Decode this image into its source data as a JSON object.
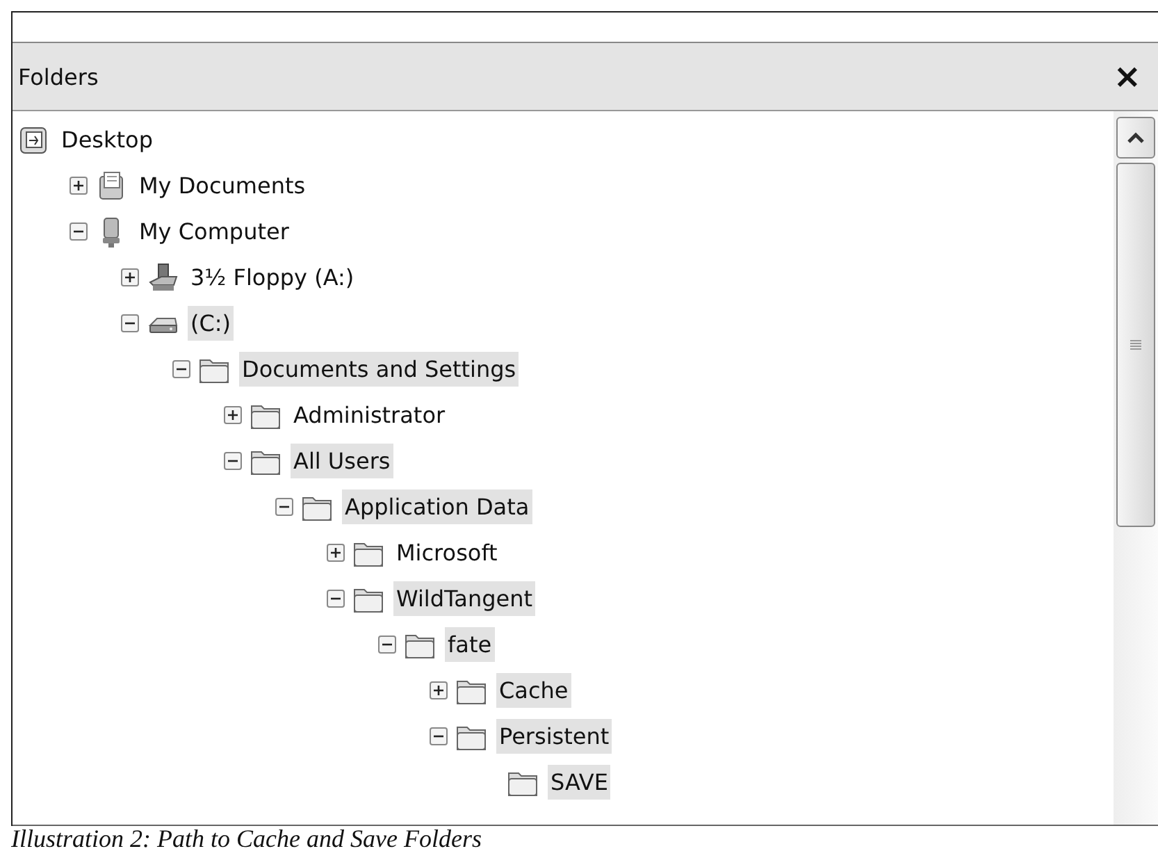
{
  "panel": {
    "title": "Folders",
    "close": "×"
  },
  "tree": [
    {
      "label": "Desktop",
      "kind": "desktop",
      "highlighted": false,
      "children": [
        {
          "label": "My Documents",
          "kind": "documents",
          "expanded": false,
          "highlighted": false
        },
        {
          "label": "My Computer",
          "kind": "computer",
          "expanded": true,
          "highlighted": false,
          "children": [
            {
              "label": "3½ Floppy (A:)",
              "kind": "floppy",
              "expanded": false,
              "highlighted": false
            },
            {
              "label": "(C:)",
              "kind": "drive",
              "expanded": true,
              "highlighted": true,
              "children": [
                {
                  "label": "Documents and Settings",
                  "kind": "folder",
                  "expanded": true,
                  "highlighted": true,
                  "children": [
                    {
                      "label": "Administrator",
                      "kind": "folder",
                      "expanded": false,
                      "highlighted": false
                    },
                    {
                      "label": "All Users",
                      "kind": "folder",
                      "expanded": true,
                      "highlighted": true,
                      "children": [
                        {
                          "label": "Application Data",
                          "kind": "folder",
                          "expanded": true,
                          "highlighted": true,
                          "children": [
                            {
                              "label": "Microsoft",
                              "kind": "folder",
                              "expanded": false,
                              "highlighted": false
                            },
                            {
                              "label": "WildTangent",
                              "kind": "folder",
                              "expanded": true,
                              "highlighted": true,
                              "children": [
                                {
                                  "label": "fate",
                                  "kind": "folder",
                                  "expanded": true,
                                  "highlighted": true,
                                  "children": [
                                    {
                                      "label": "Cache",
                                      "kind": "folder",
                                      "expanded": false,
                                      "highlighted": true
                                    },
                                    {
                                      "label": "Persistent",
                                      "kind": "folder",
                                      "expanded": true,
                                      "highlighted": true,
                                      "children": [
                                        {
                                          "label": "SAVE",
                                          "kind": "folder",
                                          "highlighted": true
                                        }
                                      ]
                                    }
                                  ]
                                }
                              ]
                            }
                          ]
                        }
                      ]
                    }
                  ]
                }
              ]
            }
          ]
        }
      ]
    }
  ],
  "caption": "Illustration 2: Path to Cache and Save Folders"
}
